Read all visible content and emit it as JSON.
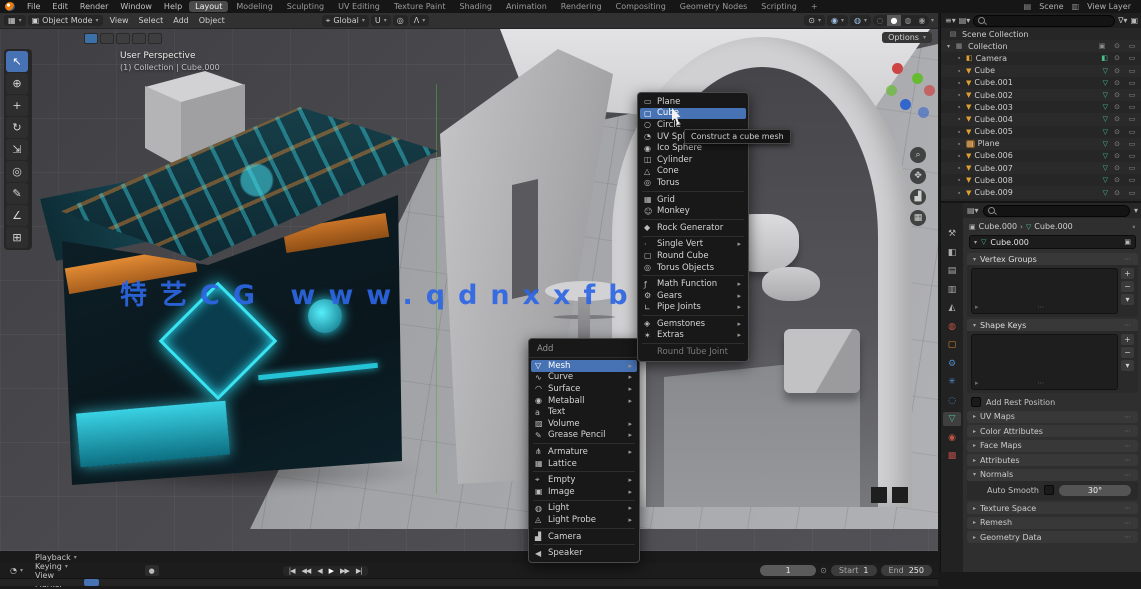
{
  "colors": {
    "accent": "#4772b3",
    "watermark_blue": "#2c66e4",
    "object_orange": "#e0a030",
    "mesh_green": "#49c08a"
  },
  "topbar": {
    "app_menus": [
      "File",
      "Edit",
      "Render",
      "Window",
      "Help"
    ],
    "workspaces": [
      {
        "label": "Layout",
        "active": true
      },
      {
        "label": "Modeling"
      },
      {
        "label": "Sculpting"
      },
      {
        "label": "UV Editing"
      },
      {
        "label": "Texture Paint"
      },
      {
        "label": "Shading"
      },
      {
        "label": "Animation"
      },
      {
        "label": "Rendering"
      },
      {
        "label": "Compositing"
      },
      {
        "label": "Geometry Nodes"
      },
      {
        "label": "Scripting"
      },
      {
        "label": "+"
      }
    ],
    "scene_label": "Scene",
    "view_layer_label": "View Layer"
  },
  "viewport_header": {
    "mode": "Object Mode",
    "menus": [
      "View",
      "Select",
      "Add",
      "Object"
    ],
    "orientation": "Global",
    "options_label": "Options"
  },
  "tools": [
    {
      "name": "tweak-select-tool",
      "glyph": "↖",
      "active": true
    },
    {
      "name": "cursor-tool",
      "glyph": "⊕"
    },
    {
      "name": "move-tool",
      "glyph": "+"
    },
    {
      "name": "rotate-tool",
      "glyph": "↻"
    },
    {
      "name": "scale-tool",
      "glyph": "⇲"
    },
    {
      "name": "transform-tool",
      "glyph": "◎"
    },
    {
      "name": "annotate-tool",
      "glyph": "✎"
    },
    {
      "name": "measure-tool",
      "glyph": "∠"
    },
    {
      "name": "add-cube-tool",
      "glyph": "⊞"
    }
  ],
  "viewport": {
    "view_label": "User Perspective",
    "context_label": "(1) Collection | Cube.000",
    "watermark": "特艺CG www.qdnxxfb.cn"
  },
  "add_menu": {
    "title": "Add",
    "items": [
      {
        "label": "Mesh",
        "icon": "mesh-icon",
        "glyph": "▽",
        "submenu": true,
        "highlight": true
      },
      {
        "label": "Curve",
        "icon": "curve-icon",
        "glyph": "∿",
        "submenu": true
      },
      {
        "label": "Surface",
        "icon": "surface-icon",
        "glyph": "◠",
        "submenu": true
      },
      {
        "label": "Metaball",
        "icon": "metaball-icon",
        "glyph": "◉",
        "submenu": true
      },
      {
        "label": "Text",
        "icon": "text-icon",
        "glyph": "a"
      },
      {
        "label": "Volume",
        "icon": "volume-icon",
        "glyph": "▨",
        "submenu": true
      },
      {
        "label": "Grease Pencil",
        "icon": "grease-pencil-icon",
        "glyph": "✎",
        "submenu": true,
        "sep_after": true
      },
      {
        "label": "Armature",
        "icon": "armature-icon",
        "glyph": "⋔",
        "submenu": true
      },
      {
        "label": "Lattice",
        "icon": "lattice-icon",
        "glyph": "▦",
        "sep_after": true
      },
      {
        "label": "Empty",
        "icon": "empty-icon",
        "glyph": "⌖",
        "submenu": true
      },
      {
        "label": "Image",
        "icon": "image-icon",
        "glyph": "▣",
        "submenu": true,
        "sep_after": true
      },
      {
        "label": "Light",
        "icon": "light-icon",
        "glyph": "◍",
        "submenu": true
      },
      {
        "label": "Light Probe",
        "icon": "light-probe-icon",
        "glyph": "◬",
        "submenu": true,
        "sep_after": true
      },
      {
        "label": "Camera",
        "icon": "camera-icon",
        "glyph": "▟",
        "sep_after": true
      },
      {
        "label": "Speaker",
        "icon": "speaker-icon",
        "glyph": "◀"
      }
    ]
  },
  "mesh_menu": {
    "tooltip": "Construct a cube mesh",
    "items": [
      {
        "label": "Plane",
        "icon": "plane-icon",
        "glyph": "▭"
      },
      {
        "label": "Cube",
        "icon": "cube-icon",
        "glyph": "▢",
        "highlight": true
      },
      {
        "label": "Circle",
        "icon": "circle-icon",
        "glyph": "○"
      },
      {
        "label": "UV Sphere",
        "icon": "uv-sphere-icon",
        "glyph": "◔"
      },
      {
        "label": "Ico Sphere",
        "icon": "ico-sphere-icon",
        "glyph": "◉"
      },
      {
        "label": "Cylinder",
        "icon": "cylinder-icon",
        "glyph": "◫"
      },
      {
        "label": "Cone",
        "icon": "cone-icon",
        "glyph": "△"
      },
      {
        "label": "Torus",
        "icon": "torus-icon",
        "glyph": "◎",
        "sep_after": true
      },
      {
        "label": "Grid",
        "icon": "grid-icon",
        "glyph": "▦"
      },
      {
        "label": "Monkey",
        "icon": "monkey-icon",
        "glyph": "☺",
        "sep_after": true
      },
      {
        "label": "Rock Generator",
        "icon": "rock-generator-icon",
        "glyph": "◆",
        "sep_after": true
      },
      {
        "label": "Single Vert",
        "icon": "single-vert-icon",
        "glyph": "·",
        "submenu": true
      },
      {
        "label": "Round Cube",
        "icon": "round-cube-icon",
        "glyph": "▢"
      },
      {
        "label": "Torus Objects",
        "icon": "torus-objects-icon",
        "glyph": "◎",
        "sep_after": true
      },
      {
        "label": "Math Function",
        "icon": "math-function-icon",
        "glyph": "ƒ",
        "submenu": true
      },
      {
        "label": "Gears",
        "icon": "gears-icon",
        "glyph": "⚙",
        "submenu": true
      },
      {
        "label": "Pipe Joints",
        "icon": "pipe-joints-icon",
        "glyph": "∟",
        "submenu": true,
        "sep_after": true
      },
      {
        "label": "Gemstones",
        "icon": "gemstones-icon",
        "glyph": "◈",
        "submenu": true
      },
      {
        "label": "Extras",
        "icon": "extras-icon",
        "glyph": "✶",
        "submenu": true,
        "sep_after": true
      },
      {
        "label": "Round Tube Joint",
        "icon": "disabled-item",
        "glyph": "",
        "disabled": true
      }
    ]
  },
  "outliner": {
    "root_label": "Scene Collection",
    "collection_label": "Collection",
    "items": [
      {
        "name": "Camera",
        "type": "camera"
      },
      {
        "name": "Cube",
        "type": "mesh"
      },
      {
        "name": "Cube.001",
        "type": "mesh"
      },
      {
        "name": "Cube.002",
        "type": "mesh"
      },
      {
        "name": "Cube.003",
        "type": "mesh"
      },
      {
        "name": "Cube.004",
        "type": "mesh"
      },
      {
        "name": "Cube.005",
        "type": "mesh"
      },
      {
        "name": "Plane",
        "type": "image",
        "active": true
      },
      {
        "name": "Cube.006",
        "type": "mesh"
      },
      {
        "name": "Cube.007",
        "type": "mesh"
      },
      {
        "name": "Cube.008",
        "type": "mesh"
      },
      {
        "name": "Cube.009",
        "type": "mesh"
      }
    ]
  },
  "properties": {
    "breadcrumb_scene": "Cube.000",
    "breadcrumb_object": "Cube.000",
    "name_value": "Cube.000",
    "vertex_groups_label": "Vertex Groups",
    "shape_keys_label": "Shape Keys",
    "rest_checkbox_label": "Add Rest Position",
    "collapsed_top": [
      "UV Maps",
      "Color Attributes",
      "Face Maps",
      "Attributes"
    ],
    "normals_label": "Normals",
    "auto_smooth_label": "Auto Smooth",
    "auto_smooth_value": "30°",
    "collapsed_bottom": [
      "Texture Space",
      "Remesh",
      "Geometry Data"
    ],
    "tabs": [
      {
        "name": "tab-tool",
        "glyph": "⚒",
        "color": "#ababab"
      },
      {
        "name": "tab-render",
        "glyph": "◧",
        "color": "#ababab"
      },
      {
        "name": "tab-output",
        "glyph": "▤",
        "color": "#ababab"
      },
      {
        "name": "tab-view-layer",
        "glyph": "▥",
        "color": "#ababab"
      },
      {
        "name": "tab-scene",
        "glyph": "◭",
        "color": "#ababab"
      },
      {
        "name": "tab-world",
        "glyph": "◍",
        "color": "#c05545"
      },
      {
        "name": "tab-object",
        "glyph": "▢",
        "color": "#d8862a"
      },
      {
        "name": "tab-modifiers",
        "glyph": "⚙",
        "color": "#4f8cc9"
      },
      {
        "name": "tab-particles",
        "glyph": "✳",
        "color": "#4f8cc9"
      },
      {
        "name": "tab-physics",
        "glyph": "◌",
        "color": "#4f8cc9"
      },
      {
        "name": "tab-object-data",
        "glyph": "▽",
        "color": "#49c08a",
        "selected": true
      },
      {
        "name": "tab-material",
        "glyph": "◉",
        "color": "#c05545"
      },
      {
        "name": "tab-texture",
        "glyph": "▩",
        "color": "#b04a4a"
      }
    ]
  },
  "timeline": {
    "menus": [
      "Playback",
      "Keying",
      "View",
      "Marker"
    ],
    "playback_buttons": [
      {
        "name": "jump-to-start-button",
        "glyph": "|◀"
      },
      {
        "name": "prev-keyframe-button",
        "glyph": "◀◀"
      },
      {
        "name": "play-reverse-button",
        "glyph": "◀"
      },
      {
        "name": "play-button",
        "glyph": "▶",
        "main": true
      },
      {
        "name": "next-keyframe-button",
        "glyph": "▶▶"
      },
      {
        "name": "jump-to-end-button",
        "glyph": "▶|"
      }
    ],
    "frame_value": "1",
    "start_label": "Start",
    "start_value": "1",
    "end_label": "End",
    "end_value": "250"
  }
}
